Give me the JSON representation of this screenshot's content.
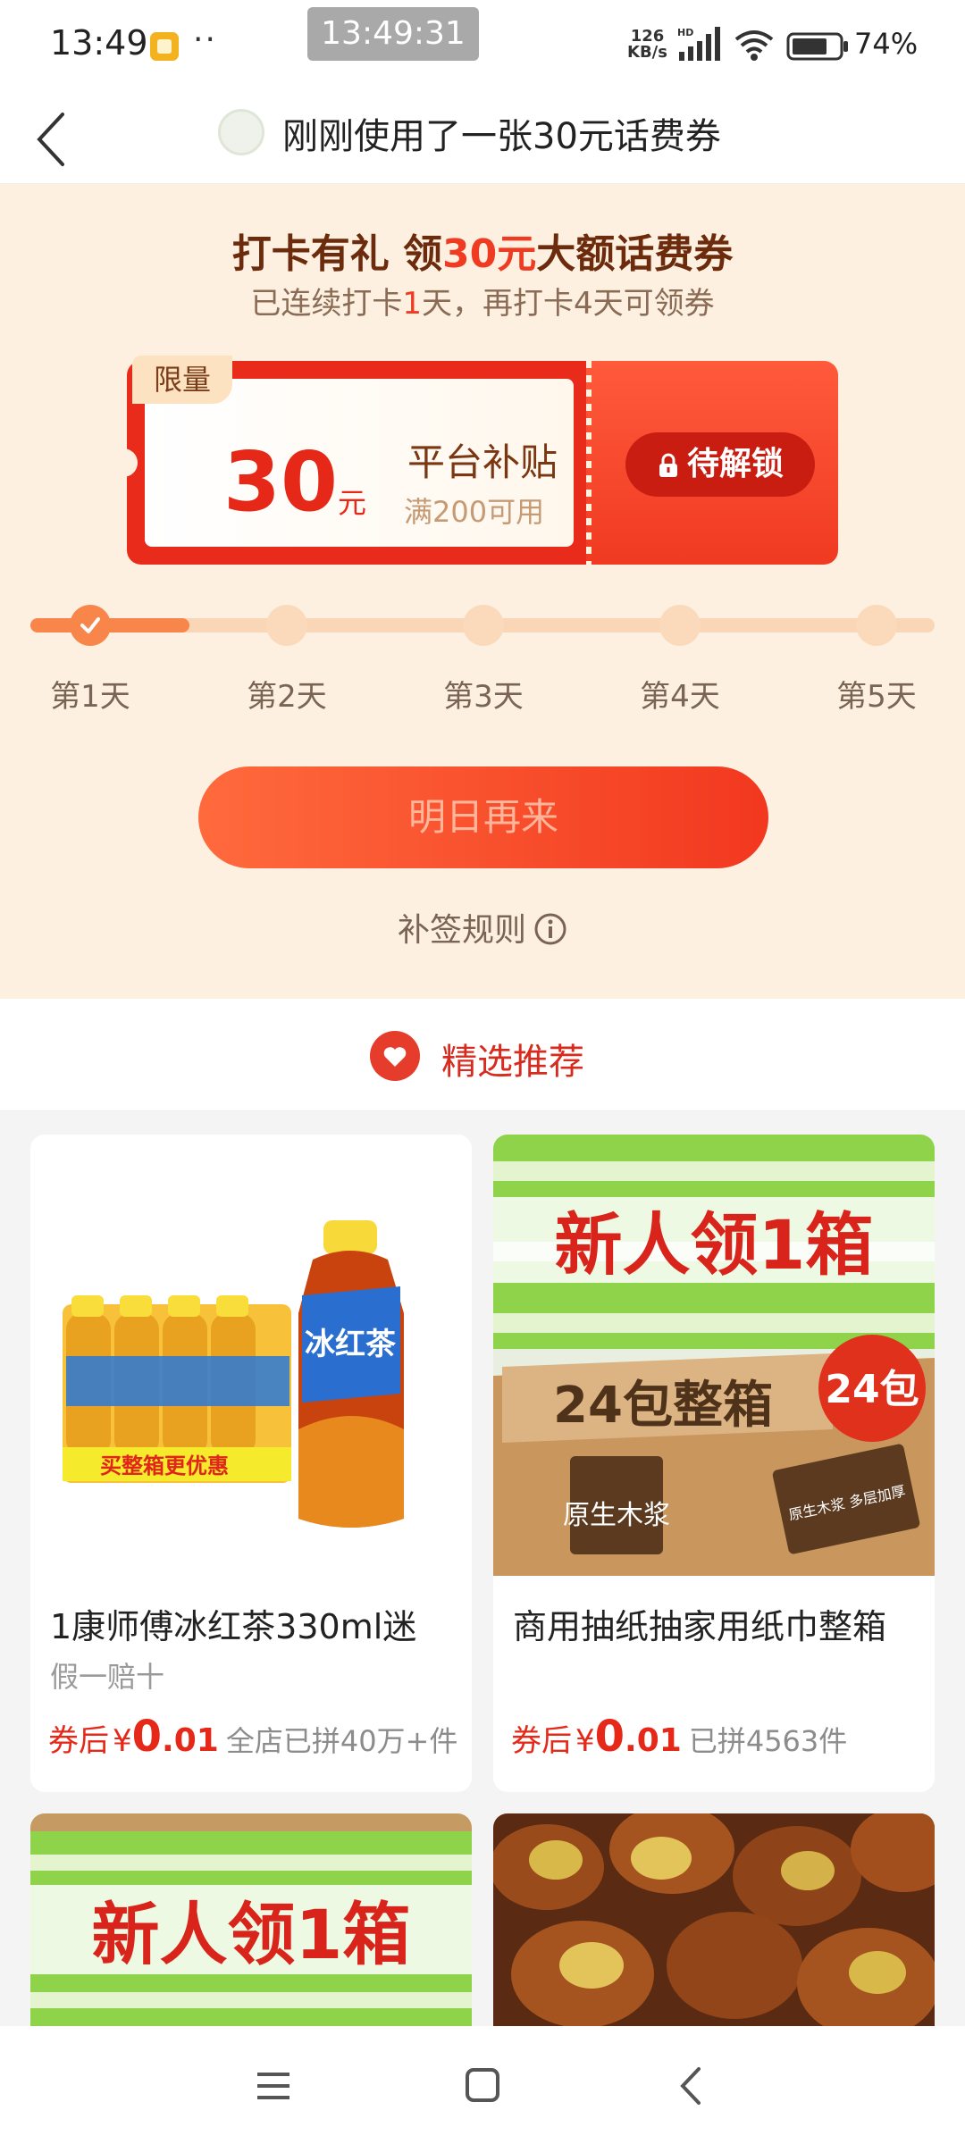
{
  "status_bar": {
    "time": "13:49",
    "dots": "··",
    "clock_overlay": "13:49:31",
    "net_speed_value": "126",
    "net_speed_unit": "KB/s",
    "network_type": "HD",
    "battery": "74%"
  },
  "header": {
    "title": "刚刚使用了一张30元话费券"
  },
  "checkin": {
    "title_prefix": "打卡有礼 领",
    "title_amount": "30元",
    "title_suffix": "大额话费券",
    "sub_prefix": "已连续打卡",
    "sub_days": "1",
    "sub_suffix": "天，再打卡4天可领券",
    "coupon": {
      "limit_tag": "限量",
      "amount": "30",
      "unit": "元",
      "name": "平台补贴",
      "condition": "满200可用",
      "unlock_label": "待解锁"
    },
    "progress": {
      "completed_days": 1,
      "total_days": 5
    },
    "days": [
      "第1天",
      "第2天",
      "第3天",
      "第4天",
      "第5天"
    ],
    "come_back_label": "明日再来",
    "rules_label": "补签规则"
  },
  "recommend": {
    "title": "精选推荐"
  },
  "products": [
    {
      "title": "1康师傅冰红茶330ml迷",
      "tag": "假一赔十",
      "price_prefix": "券后",
      "currency": "¥",
      "price_int": "0",
      "price_dec": ".01",
      "sold": "全店已拼40万+件",
      "image_text": "冰红茶",
      "image_banner": "买整箱更优惠"
    },
    {
      "title": "商用抽纸抽家用纸巾整箱",
      "tag": "",
      "price_prefix": "券后",
      "currency": "¥",
      "price_int": "0",
      "price_dec": ".01",
      "sold": "已拼4563件",
      "image_headline": "新人领1箱",
      "image_box_text": "24包整箱",
      "image_badge": "24包",
      "image_left_label": "原生木浆",
      "image_right_label": "原生木浆 多层加厚"
    },
    {
      "image_headline": "新人领1箱"
    },
    {
      "image_desc": "nuts"
    }
  ],
  "colors": {
    "brand_red": "#e62818",
    "checkin_bg": "#fdf0e0",
    "accent_orange": "#f8864a"
  }
}
